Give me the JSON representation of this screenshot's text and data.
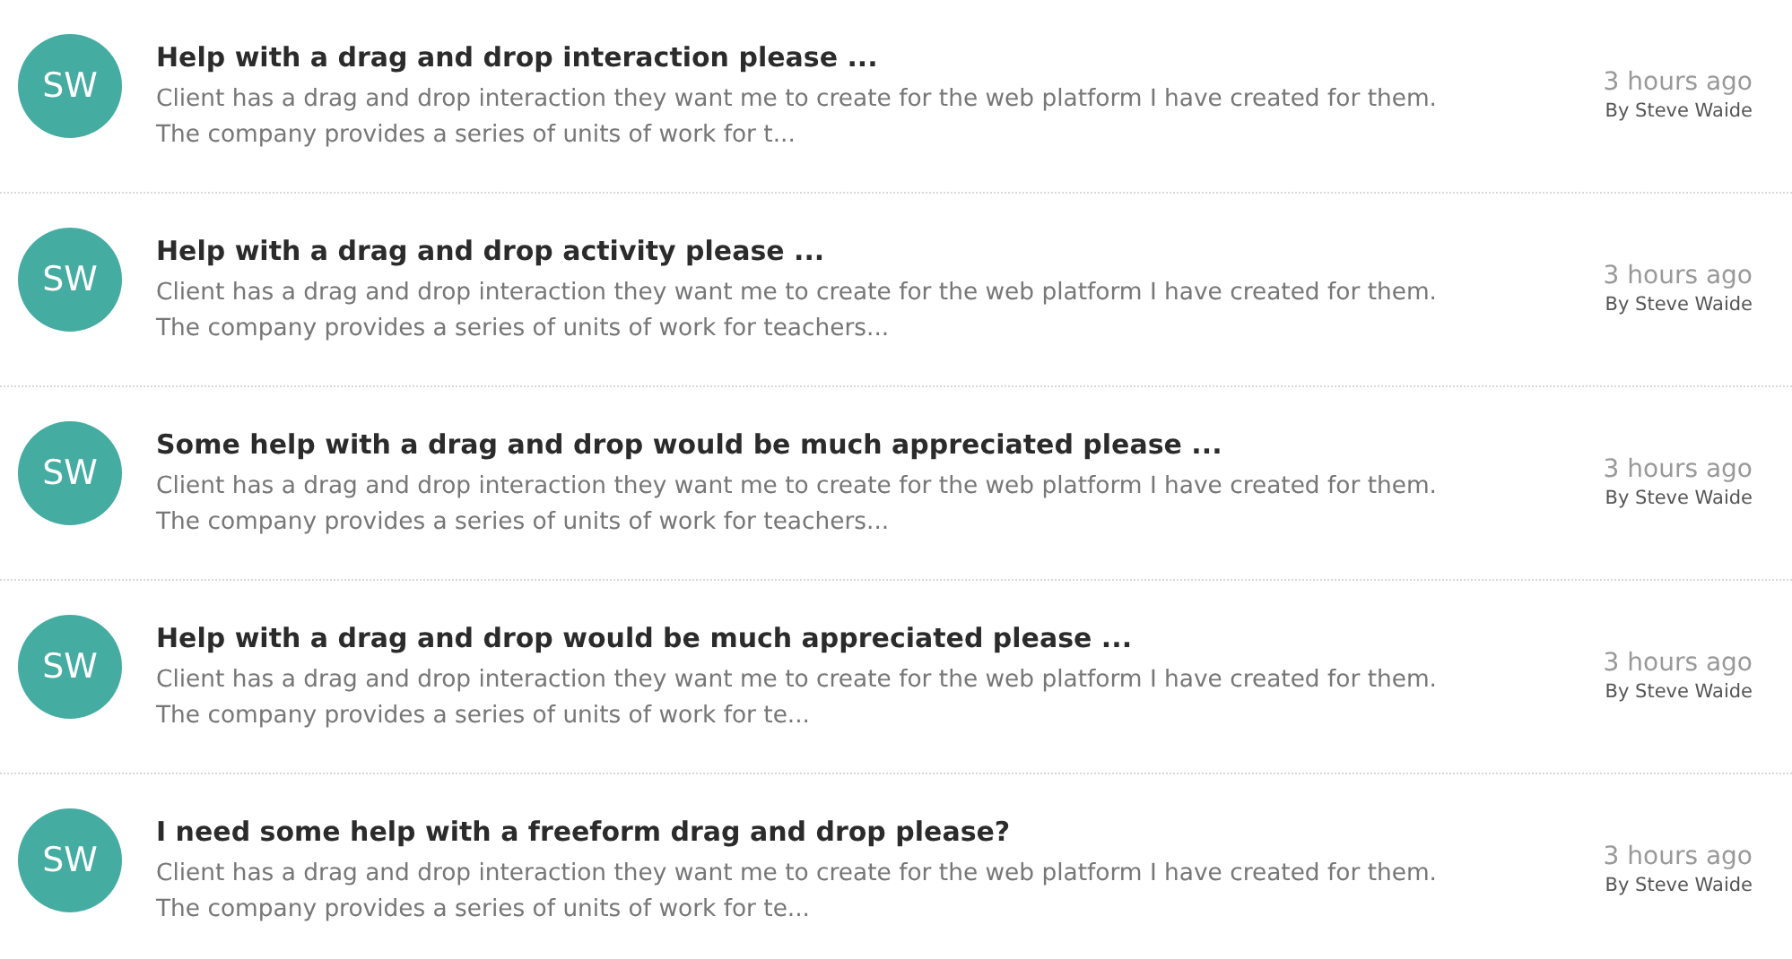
{
  "posts": [
    {
      "avatar": "SW",
      "title": "Help with a drag and drop interaction please ...",
      "excerpt": "Client has a drag and drop interaction they want me to create for the web platform I have created for them. The company provides a series of units of work for t...",
      "time": "3 hours ago",
      "author": "By Steve Waide"
    },
    {
      "avatar": "SW",
      "title": "Help with a drag and drop activity please ...",
      "excerpt": "Client has a drag and drop interaction they want me to create for the web platform I have created for them. The company provides a series of units of work for teachers...",
      "time": "3 hours ago",
      "author": "By Steve Waide"
    },
    {
      "avatar": "SW",
      "title": "Some help with a drag and drop would be much appreciated please ...",
      "excerpt": "Client has a drag and drop interaction they want me to create for the web platform I have created for them. The company provides a series of units of work for teachers...",
      "time": "3 hours ago",
      "author": "By Steve Waide"
    },
    {
      "avatar": "SW",
      "title": "Help with a drag and drop would be much appreciated please ...",
      "excerpt": "Client has a drag and drop interaction they want me to create for the web platform I have created for them. The company provides a series of units of work for te...",
      "time": "3 hours ago",
      "author": "By Steve Waide"
    },
    {
      "avatar": "SW",
      "title": "I need some help with a freeform drag and drop please?",
      "excerpt": "Client has a drag and drop interaction they want me to create for the web platform I have created for them. The company provides a series of units of work for te...",
      "time": "3 hours ago",
      "author": "By Steve Waide"
    }
  ]
}
